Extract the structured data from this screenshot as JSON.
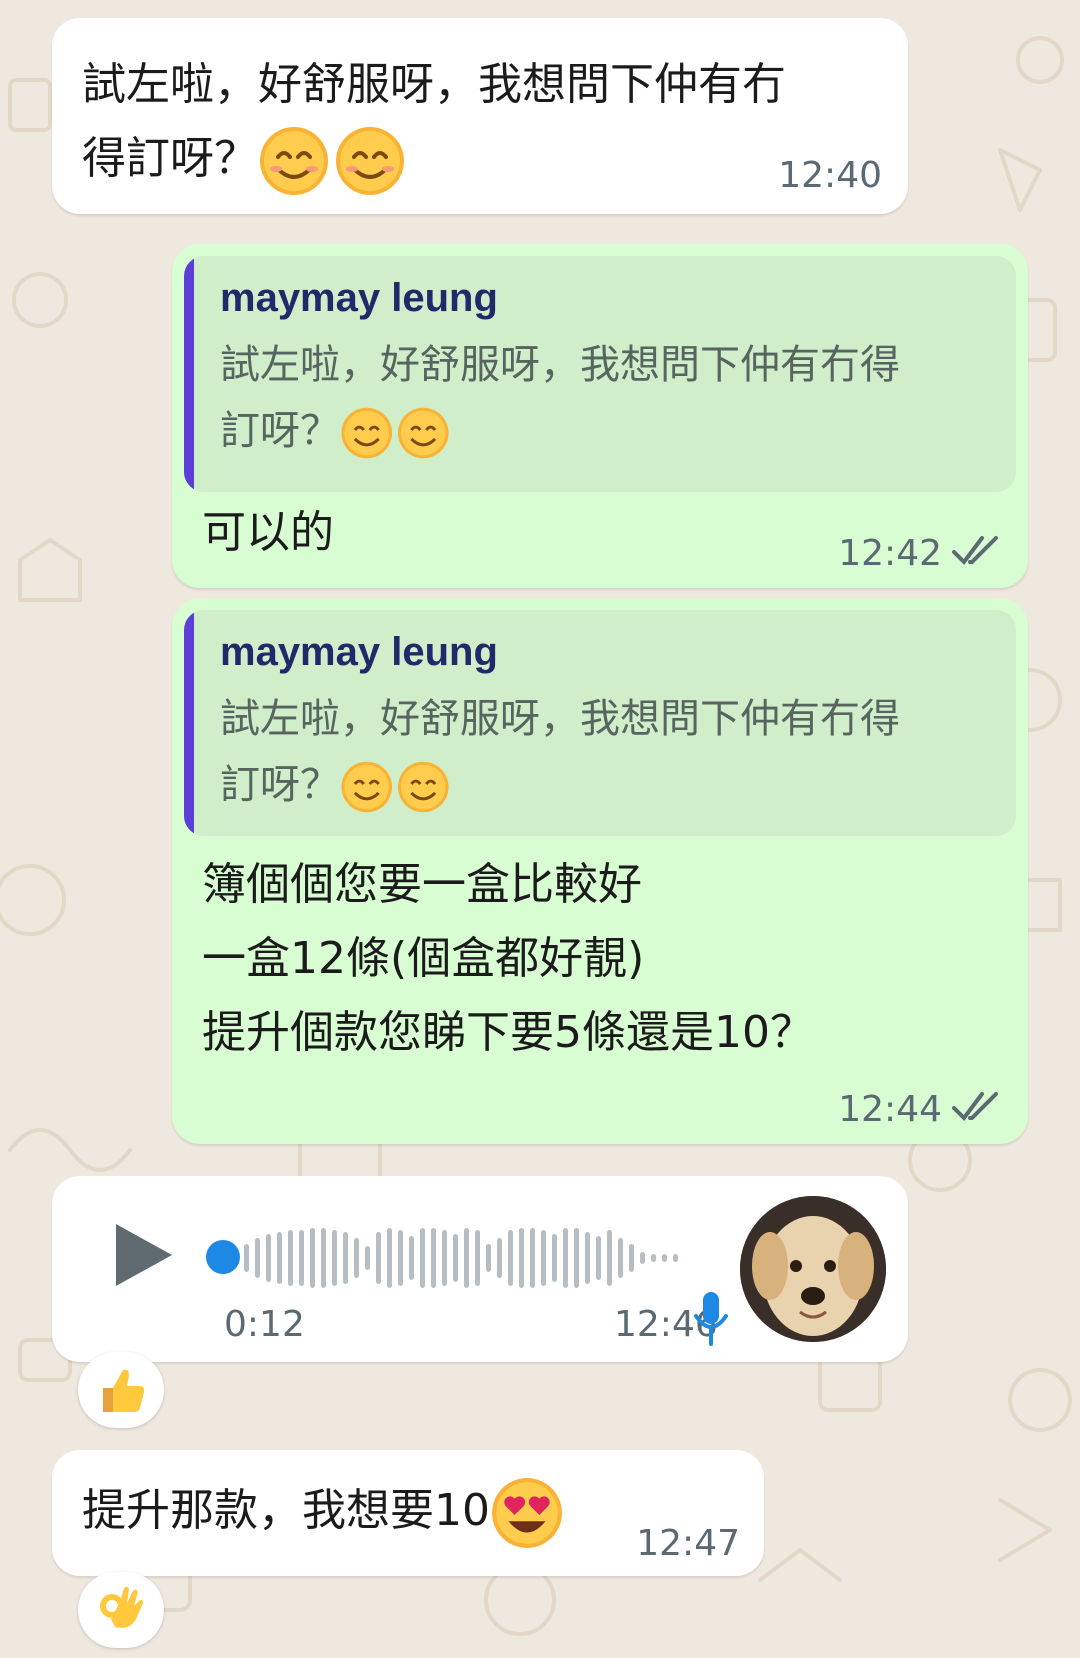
{
  "colors": {
    "incoming_bubble": "#ffffff",
    "outgoing_bubble": "#d9fdd3",
    "quote_bar": "#5b3fd8",
    "voice_accent": "#1e88e5",
    "chat_background": "#efe8de"
  },
  "messages": [
    {
      "direction": "incoming",
      "text_line1": "試左啦，好舒服呀，我想問下仲有冇",
      "text_line2": "得訂呀？",
      "emoji": "smiling-face-icon",
      "time": "12:40"
    },
    {
      "direction": "outgoing",
      "quote": {
        "author": "maymay leung",
        "line1": "試左啦，好舒服呀，我想問下仲有冇得",
        "line2": "訂呀？"
      },
      "text": "可以的",
      "time": "12:42",
      "status": "read"
    },
    {
      "direction": "outgoing",
      "quote": {
        "author": "maymay leung",
        "line1": "試左啦，好舒服呀，我想問下仲有冇得",
        "line2": "訂呀？"
      },
      "lines": [
        "簿個個您要一盒比較好",
        "一盒12條(個盒都好靚)",
        "提升個款您睇下要5條還是10？"
      ],
      "time": "12:44",
      "status": "read"
    },
    {
      "direction": "incoming",
      "type": "voice",
      "duration": "0:12",
      "time": "12:46",
      "reaction": "thumbs-up-icon"
    },
    {
      "direction": "incoming",
      "text": "提升那款，我想要10",
      "emoji": "heart-eyes-icon",
      "time": "12:47",
      "reaction": "ok-hand-icon"
    }
  ]
}
